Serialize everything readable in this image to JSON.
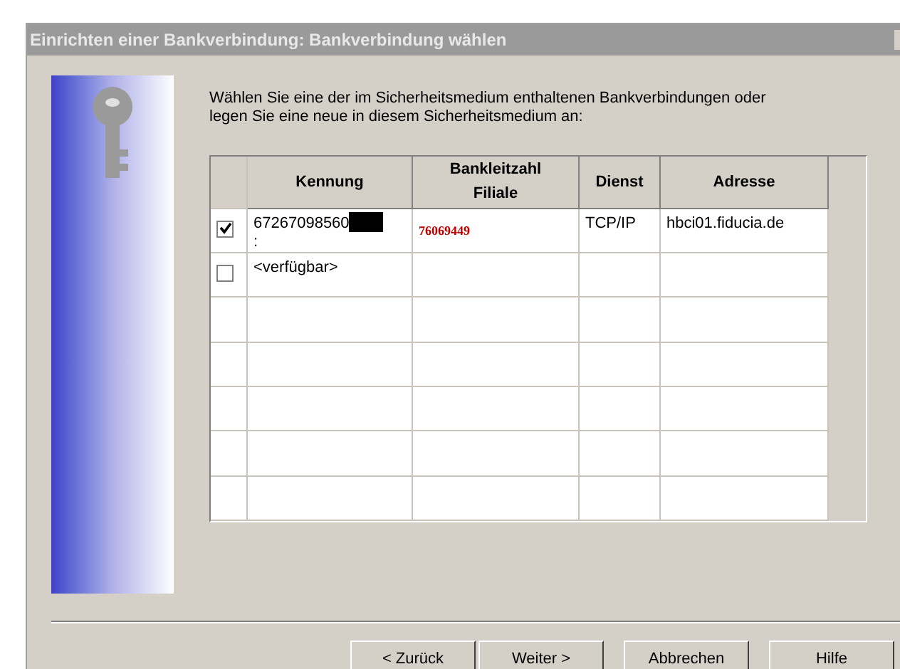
{
  "window": {
    "title": "Einrichten einer Bankverbindung: Bankverbindung wählen",
    "active": false
  },
  "instruction": "Wählen Sie eine der im Sicherheitsmedium enthaltenen Bankverbindungen oder legen Sie eine neue in diesem Sicherheitsmedium an:",
  "table": {
    "columns": [
      "Kennung",
      "Bankleitzahl Filiale",
      "Dienst",
      "Adresse"
    ],
    "rows": [
      {
        "checked": true,
        "kennung": "67267098560",
        "kennung_line_2": ":",
        "redacted": true,
        "bankleitzahl": "76069449",
        "dienst": "TCP/IP",
        "adresse": "hbci01.fiducia.de"
      },
      {
        "checked": false,
        "kennung": "<verfügbar>",
        "redacted": false
      }
    ]
  },
  "buttons": [
    "< Zurück",
    "Weiter >",
    "Abbrechen",
    "Hilfe"
  ]
}
